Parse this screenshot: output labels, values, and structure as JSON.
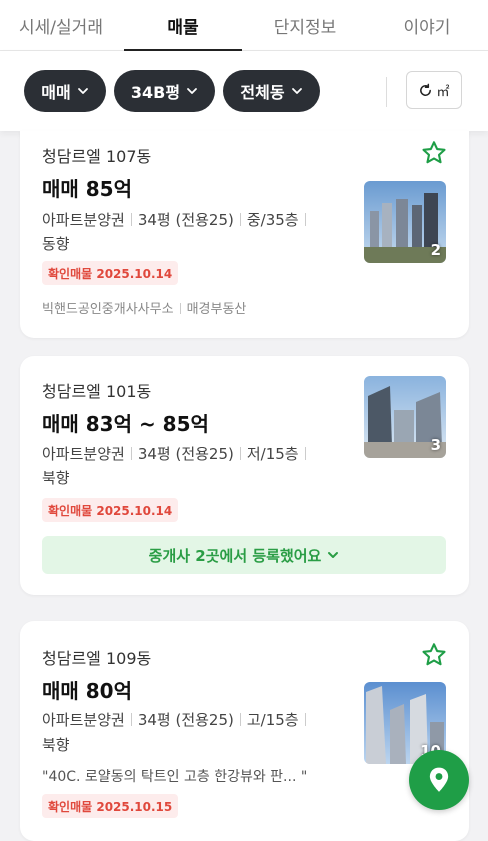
{
  "tabs": [
    "시세/실거래",
    "매물",
    "단지정보",
    "이야기"
  ],
  "filters": {
    "trade_type": "매매",
    "size": "34B평",
    "building": "전체동",
    "unit_toggle": "㎡"
  },
  "listings": [
    {
      "name": "청담르엘 107동",
      "price": "매매 85억",
      "info_line1": [
        "아파트분양권",
        "34평 (전용25)",
        "중/35층"
      ],
      "info_line2": "동향",
      "badge": "확인매물 2025.10.14",
      "agents": [
        "빅핸드공인중개사사무소",
        "매경부동산"
      ],
      "photo_count": "2",
      "favorite": true
    },
    {
      "name": "청담르엘 101동",
      "price": "매매 83억 ~ 85억",
      "info_line1": [
        "아파트분양권",
        "34평 (전용25)",
        "저/15층"
      ],
      "info_line2": "북향",
      "badge": "확인매물 2025.10.14",
      "agent_summary": "중개사 2곳에서 등록했어요",
      "photo_count": "3",
      "favorite": false
    },
    {
      "name": "청담르엘 109동",
      "price": "매매 80억",
      "info_line1": [
        "아파트분양권",
        "34평 (전용25)",
        "고/15층"
      ],
      "info_line2": "북향",
      "description": "\"40C. 로얄동의 탁트인 고층 한강뷰와 판...   \"",
      "badge": "확인매물 2025.10.15",
      "photo_count": "10",
      "favorite": true
    }
  ],
  "icons": {
    "star": "star-outline-icon",
    "reset": "refresh-icon",
    "map": "map-pin-icon"
  },
  "colors": {
    "accent_green": "#1f9e47",
    "chip_dark": "#2b2f35",
    "badge_red": "#e0483c"
  }
}
